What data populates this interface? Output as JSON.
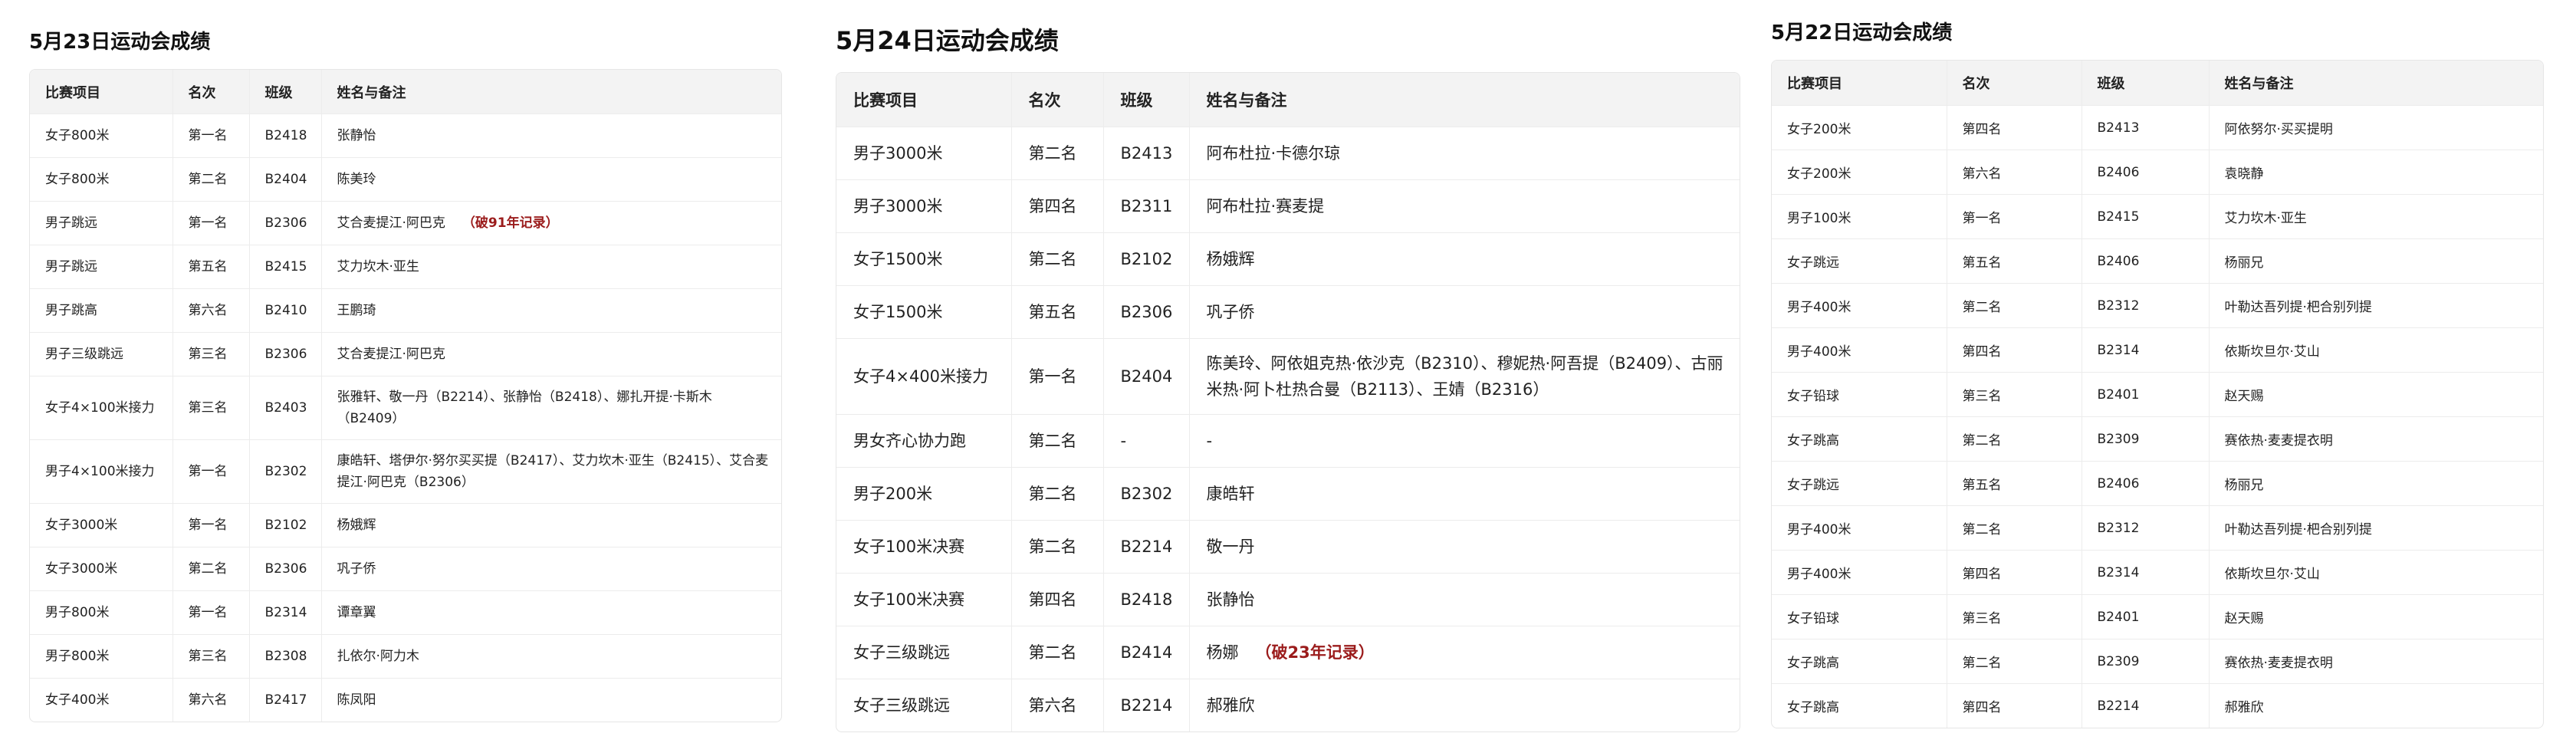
{
  "panels": [
    {
      "title": "5月23日运动会成绩",
      "headers": [
        "比赛项目",
        "名次",
        "班级",
        "姓名与备注"
      ],
      "rows": [
        {
          "event": "女子800米",
          "rank": "第一名",
          "class": "B2418",
          "name": "张静怡",
          "note": ""
        },
        {
          "event": "女子800米",
          "rank": "第二名",
          "class": "B2404",
          "name": "陈美玲",
          "note": ""
        },
        {
          "event": "男子跳远",
          "rank": "第一名",
          "class": "B2306",
          "name": "艾合麦提江·阿巴克",
          "note": "（破91年记录）"
        },
        {
          "event": "男子跳远",
          "rank": "第五名",
          "class": "B2415",
          "name": "艾力坎木·亚生",
          "note": ""
        },
        {
          "event": "男子跳高",
          "rank": "第六名",
          "class": "B2410",
          "name": "王鹏琦",
          "note": ""
        },
        {
          "event": "男子三级跳远",
          "rank": "第三名",
          "class": "B2306",
          "name": "艾合麦提江·阿巴克",
          "note": ""
        },
        {
          "event": "女子4×100米接力",
          "rank": "第三名",
          "class": "B2403",
          "name": "张雅轩、敬一丹（B2214）、张静怡（B2418）、娜扎开提·卡斯木（B2409）",
          "note": ""
        },
        {
          "event": "男子4×100米接力",
          "rank": "第一名",
          "class": "B2302",
          "name": "康皓轩、塔伊尔·努尔买买提（B2417）、艾力坎木·亚生（B2415）、艾合麦提江·阿巴克（B2306）",
          "note": ""
        },
        {
          "event": "女子3000米",
          "rank": "第一名",
          "class": "B2102",
          "name": "杨娥辉",
          "note": ""
        },
        {
          "event": "女子3000米",
          "rank": "第二名",
          "class": "B2306",
          "name": "巩子侨",
          "note": ""
        },
        {
          "event": "男子800米",
          "rank": "第一名",
          "class": "B2314",
          "name": "谭章翼",
          "note": ""
        },
        {
          "event": "男子800米",
          "rank": "第三名",
          "class": "B2308",
          "name": "扎依尔·阿力木",
          "note": ""
        },
        {
          "event": "女子400米",
          "rank": "第六名",
          "class": "B2417",
          "name": "陈凤阳",
          "note": ""
        }
      ]
    },
    {
      "title": "5月24日运动会成绩",
      "headers": [
        "比赛项目",
        "名次",
        "班级",
        "姓名与备注"
      ],
      "rows": [
        {
          "event": "男子3000米",
          "rank": "第二名",
          "class": "B2413",
          "name": "阿布杜拉·卡德尔琼",
          "note": ""
        },
        {
          "event": "男子3000米",
          "rank": "第四名",
          "class": "B2311",
          "name": "阿布杜拉·赛麦提",
          "note": ""
        },
        {
          "event": "女子1500米",
          "rank": "第二名",
          "class": "B2102",
          "name": "杨娥辉",
          "note": ""
        },
        {
          "event": "女子1500米",
          "rank": "第五名",
          "class": "B2306",
          "name": "巩子侨",
          "note": ""
        },
        {
          "event": "女子4×400米接力",
          "rank": "第一名",
          "class": "B2404",
          "name": "陈美玲、阿依姐克热·依沙克（B2310）、穆妮热·阿吾提（B2409）、古丽米热·阿卜杜热合曼（B2113）、王婧（B2316）",
          "note": ""
        },
        {
          "event": "男女齐心协力跑",
          "rank": "第二名",
          "class": "-",
          "name": "-",
          "note": ""
        },
        {
          "event": "男子200米",
          "rank": "第二名",
          "class": "B2302",
          "name": "康皓轩",
          "note": ""
        },
        {
          "event": "女子100米决赛",
          "rank": "第二名",
          "class": "B2214",
          "name": "敬一丹",
          "note": ""
        },
        {
          "event": "女子100米决赛",
          "rank": "第四名",
          "class": "B2418",
          "name": "张静怡",
          "note": ""
        },
        {
          "event": "女子三级跳远",
          "rank": "第二名",
          "class": "B2414",
          "name": "杨娜",
          "note": "（破23年记录）"
        },
        {
          "event": "女子三级跳远",
          "rank": "第六名",
          "class": "B2214",
          "name": "郝雅欣",
          "note": ""
        }
      ]
    },
    {
      "title": "5月22日运动会成绩",
      "headers": [
        "比赛项目",
        "名次",
        "班级",
        "姓名与备注"
      ],
      "rows": [
        {
          "event": "女子200米",
          "rank": "第四名",
          "class": "B2413",
          "name": "阿依努尔·买买提明",
          "note": ""
        },
        {
          "event": "女子200米",
          "rank": "第六名",
          "class": "B2406",
          "name": "袁晓静",
          "note": ""
        },
        {
          "event": "男子100米",
          "rank": "第一名",
          "class": "B2415",
          "name": "艾力坎木·亚生",
          "note": ""
        },
        {
          "event": "女子跳远",
          "rank": "第五名",
          "class": "B2406",
          "name": "杨丽兄",
          "note": ""
        },
        {
          "event": "男子400米",
          "rank": "第二名",
          "class": "B2312",
          "name": "叶勒达吾列提·杷合别列提",
          "note": ""
        },
        {
          "event": "男子400米",
          "rank": "第四名",
          "class": "B2314",
          "name": "依斯坎旦尔·艾山",
          "note": ""
        },
        {
          "event": "女子铅球",
          "rank": "第三名",
          "class": "B2401",
          "name": "赵天赐",
          "note": ""
        },
        {
          "event": "女子跳高",
          "rank": "第二名",
          "class": "B2309",
          "name": "赛依热·麦麦提衣明",
          "note": ""
        },
        {
          "event": "女子跳远",
          "rank": "第五名",
          "class": "B2406",
          "name": "杨丽兄",
          "note": ""
        },
        {
          "event": "男子400米",
          "rank": "第二名",
          "class": "B2312",
          "name": "叶勒达吾列提·杷合别列提",
          "note": ""
        },
        {
          "event": "男子400米",
          "rank": "第四名",
          "class": "B2314",
          "name": "依斯坎旦尔·艾山",
          "note": ""
        },
        {
          "event": "女子铅球",
          "rank": "第三名",
          "class": "B2401",
          "name": "赵天赐",
          "note": ""
        },
        {
          "event": "女子跳高",
          "rank": "第二名",
          "class": "B2309",
          "name": "赛依热·麦麦提衣明",
          "note": ""
        },
        {
          "event": "女子跳高",
          "rank": "第四名",
          "class": "B2214",
          "name": "郝雅欣",
          "note": ""
        }
      ]
    }
  ]
}
